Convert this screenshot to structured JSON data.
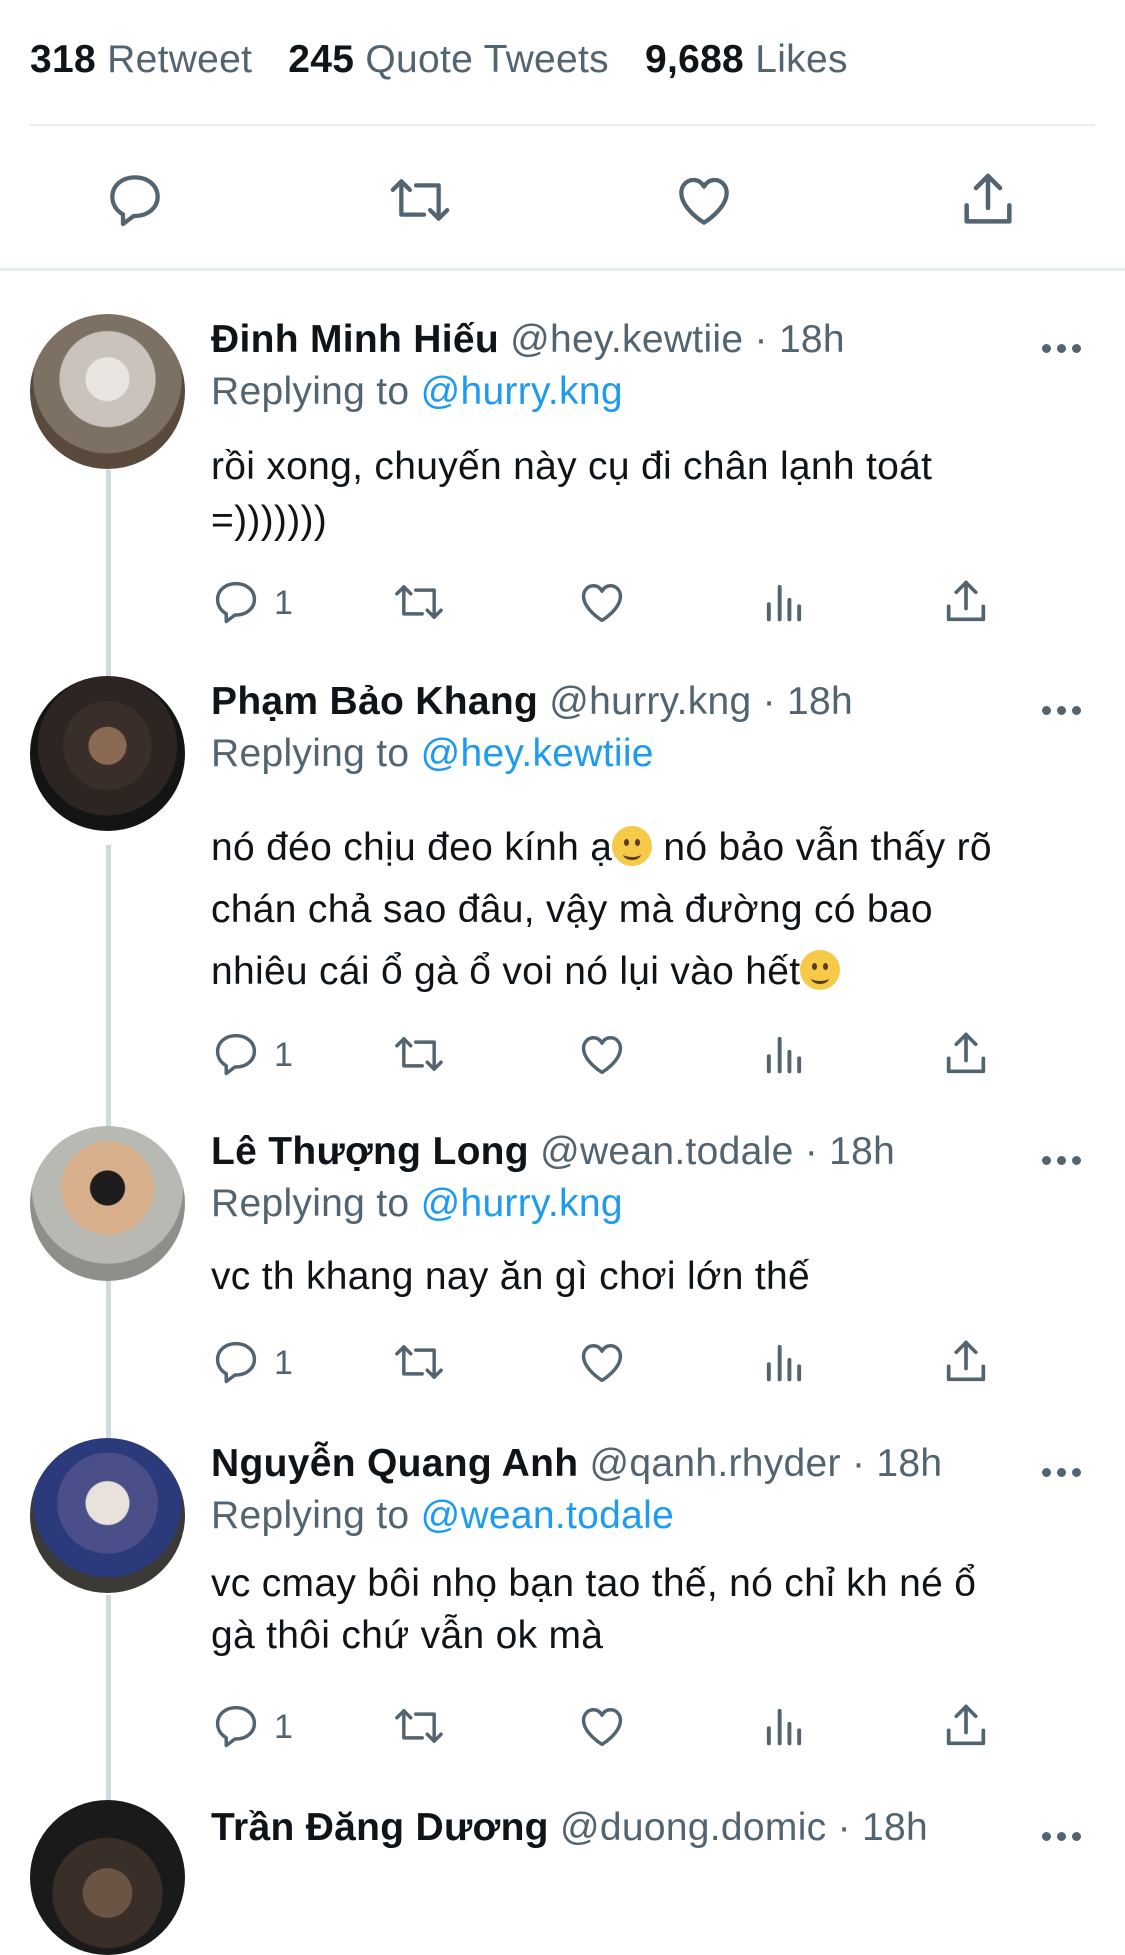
{
  "stats": {
    "retweets": {
      "count": "318",
      "label": "Retweet"
    },
    "quotes": {
      "count": "245",
      "label": "Quote Tweets"
    },
    "likes": {
      "count": "9,688",
      "label": "Likes"
    }
  },
  "action_bar": {
    "icons": [
      "reply-icon",
      "retweet-icon",
      "like-icon",
      "share-icon"
    ]
  },
  "replies": [
    {
      "name": "Đinh Minh Hiếu",
      "handle": "@hey.kewtiie",
      "time": "· 18h",
      "replying_prefix": "Replying to",
      "replying_to": "@hurry.kng",
      "lines": [
        "rồi xong, chuyến này cụ đi chân lạnh toát",
        "=)))))))"
      ],
      "reply_count": "1",
      "avatar_colors": [
        "#c9c3bb",
        "#e9e6e1",
        "#5a4a3e"
      ]
    },
    {
      "name": "Phạm Bảo Khang",
      "handle": "@hurry.kng",
      "time": "· 18h",
      "replying_prefix": "Replying to",
      "replying_to": "@hey.kewtiie",
      "lines": [
        "nó đéo chịu đeo kính ạ",
        " nó bảo vẫn thấy rõ",
        "chán chả sao đâu, vậy mà đường có bao",
        "nhiêu cái ổ gà ổ voi nó lụi vào hết"
      ],
      "reply_count": "1",
      "avatar_colors": [
        "#141414",
        "#2c2522",
        "#8a6a55"
      ]
    },
    {
      "name": "Lê Thượng Long",
      "handle": "@wean.todale",
      "time": "· 18h",
      "replying_prefix": "Replying to",
      "replying_to": "@hurry.kng",
      "lines": [
        "vc th khang nay ăn gì chơi lớn thế"
      ],
      "reply_count": "1",
      "avatar_colors": [
        "#b9b9b4",
        "#d9b08c",
        "#1c1c1c"
      ]
    },
    {
      "name": "Nguyễn Quang Anh",
      "handle": "@qanh.rhyder",
      "time": "· 18h",
      "replying_prefix": "Replying to",
      "replying_to": "@wean.todale",
      "lines": [
        "vc cmay bôi nhọ bạn tao thế, nó chỉ kh né ổ",
        "gà thôi chứ vẫn ok mà"
      ],
      "reply_count": "1",
      "avatar_colors": [
        "#3c3a36",
        "#e8e2da",
        "#2a3a7a"
      ]
    },
    {
      "name": "Trần Đăng Dương",
      "handle": "@duong.domic",
      "time": "· 18h",
      "avatar_colors": [
        "#1a1a1a",
        "#3a2e28",
        "#6b5444"
      ]
    }
  ],
  "colors": {
    "accent": "#1d9bf0",
    "muted": "#536471",
    "text": "#0f1419",
    "divider": "#e6ecf0"
  }
}
